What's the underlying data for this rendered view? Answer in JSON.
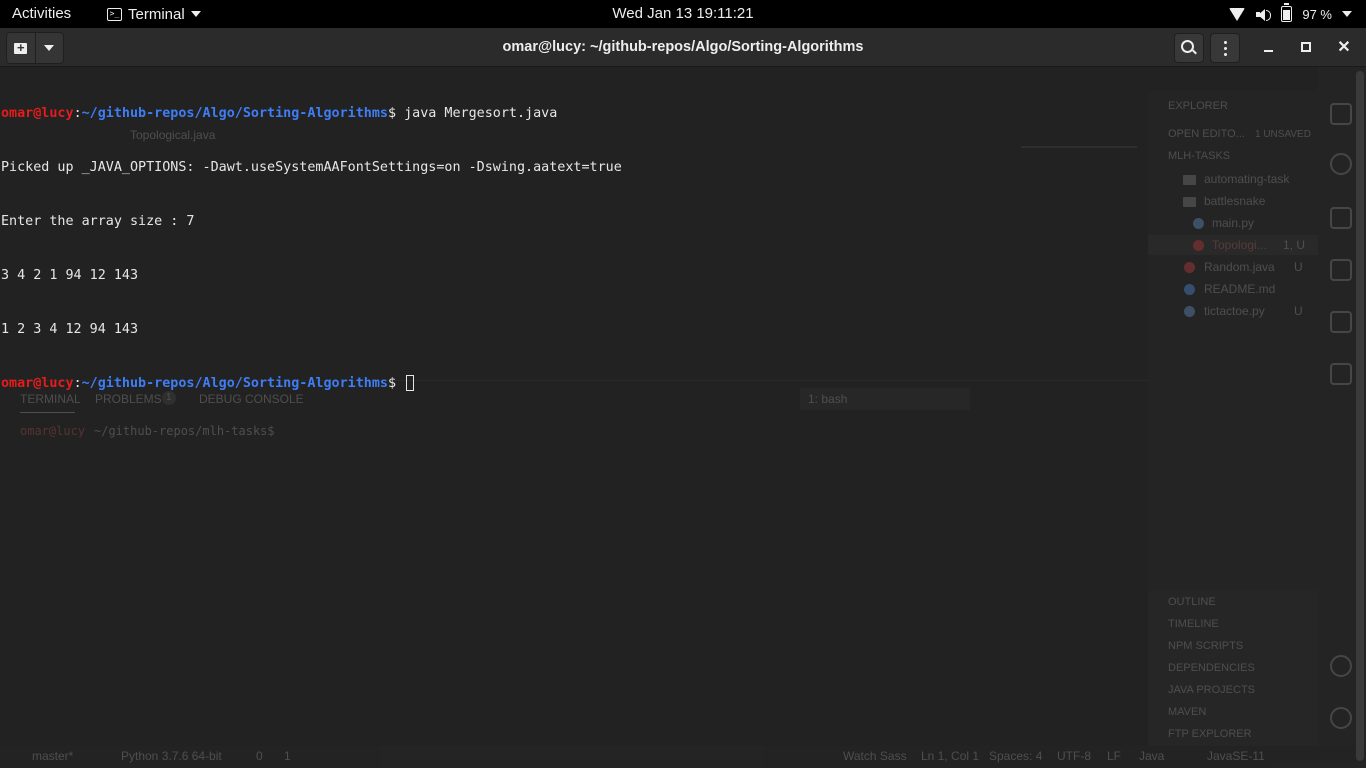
{
  "topbar": {
    "activities": "Activities",
    "app_name": "Terminal",
    "clock": "Wed Jan 13  19:11:21",
    "battery": "97 %"
  },
  "window": {
    "title": "omar@lucy: ~/github-repos/Algo/Sorting-Algorithms"
  },
  "terminal": {
    "prompt_user": "omar@lucy",
    "prompt_sep": ":",
    "prompt_path": "~/github-repos/Algo/Sorting-Algorithms",
    "prompt_end": "$ ",
    "command": "java Mergesort.java",
    "output": [
      "Picked up _JAVA_OPTIONS: -Dawt.useSystemAAFontSettings=on -Dswing.aatext=true",
      "Enter the array size : 7",
      "3 4 2 1 94 12 143",
      "1 2 3 4 12 94 143"
    ]
  },
  "background_editor": {
    "tab_label": "Topological.java",
    "explorer": {
      "title": "EXPLORER",
      "open_editors": "OPEN EDITO...",
      "unsaved": "1 UNSAVED",
      "root": "MLH-TASKS",
      "items": [
        {
          "label": "automating-task",
          "mark": ""
        },
        {
          "label": "battlesnake",
          "mark": ""
        },
        {
          "label": "main.py",
          "mark": ""
        },
        {
          "label": "Topologi...",
          "mark": "1, U"
        },
        {
          "label": "Random.java",
          "mark": "U"
        },
        {
          "label": "README.md",
          "mark": ""
        },
        {
          "label": "tictactoe.py",
          "mark": "U"
        }
      ],
      "sections": [
        "OUTLINE",
        "TIMELINE",
        "NPM SCRIPTS",
        "DEPENDENCIES",
        "JAVA PROJECTS",
        "MAVEN",
        "FTP EXPLORER"
      ]
    },
    "panel": {
      "tabs": [
        "TERMINAL",
        "PROBLEMS",
        "DEBUG CONSOLE"
      ],
      "problems_count": "1",
      "shell_select": "1: bash",
      "prompt_user": "omar@lucy",
      "prompt_path": "~/github-repos/mlh-tasks$"
    },
    "status": {
      "branch": "master*",
      "python": "Python 3.7.6 64-bit",
      "errors": "0",
      "warnings": "1",
      "watch": "Watch Sass",
      "position": "Ln 1, Col 1",
      "spaces": "Spaces: 4",
      "encoding": "UTF-8",
      "eol": "LF",
      "language": "Java",
      "jdk": "JavaSE-11"
    }
  },
  "colors": {
    "prompt_user": "#e61c1c",
    "prompt_path": "#3f7df5",
    "terminal_bg": "#222222",
    "topbar_bg": "#000000",
    "headerbar_bg": "#2b2b2b"
  }
}
